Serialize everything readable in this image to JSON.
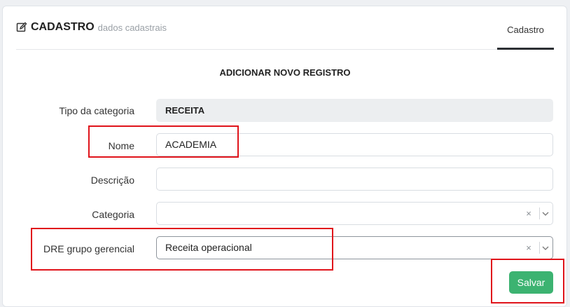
{
  "header": {
    "title": "CADASTRO",
    "subtitle": "dados cadastrais",
    "tab_label": "Cadastro"
  },
  "form": {
    "section_title": "ADICIONAR NOVO REGISTRO",
    "fields": {
      "tipo_categoria": {
        "label": "Tipo da categoria",
        "value": "RECEITA"
      },
      "nome": {
        "label": "Nome",
        "value": "ACADEMIA"
      },
      "descricao": {
        "label": "Descrição",
        "value": ""
      },
      "categoria": {
        "label": "Categoria",
        "value": "",
        "clear": "×"
      },
      "dre_grupo": {
        "label": "DRE grupo gerencial",
        "value": "Receita operacional",
        "clear": "×"
      }
    },
    "save_label": "Salvar"
  },
  "colors": {
    "accent_green": "#3cb371",
    "highlight_red": "#e0141b"
  }
}
